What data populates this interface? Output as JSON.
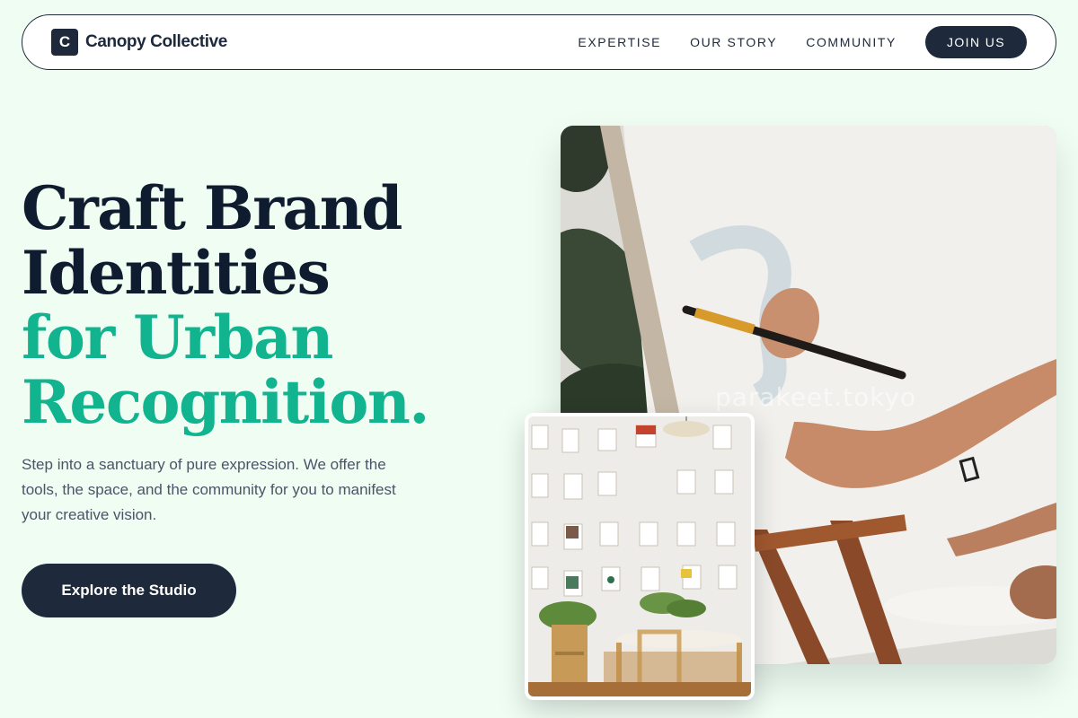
{
  "brand": {
    "logo_letter": "C",
    "name": "Canopy Collective"
  },
  "nav": {
    "links": [
      "EXPERTISE",
      "OUR STORY",
      "COMMUNITY"
    ],
    "join_label": "JOIN US"
  },
  "hero": {
    "title_line1": "Craft Brand",
    "title_line2": "Identities",
    "title_line3": "for Urban",
    "title_line4": "Recognition.",
    "description": "Step into a sanctuary of pure expression. We offer the tools, the space, and the community for you to manifest your creative vision.",
    "cta_label": "Explore the Studio"
  },
  "images": {
    "main_watermark": "parakeet.tokyo"
  },
  "colors": {
    "background": "#effdf3",
    "navy": "#1e293b",
    "accent_green": "#11b48e"
  }
}
